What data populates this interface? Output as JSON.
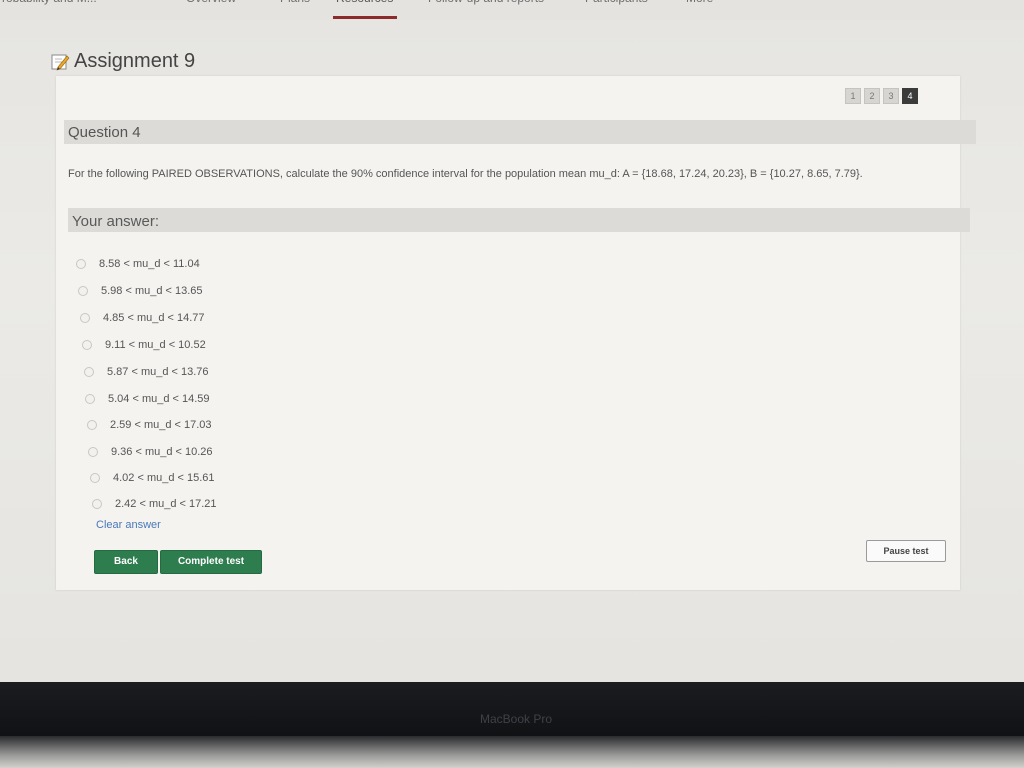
{
  "nav": {
    "tabs": [
      {
        "label": "Probability and M..."
      },
      {
        "label": "Overview"
      },
      {
        "label": "Plans"
      },
      {
        "label": "Resources"
      },
      {
        "label": "Follow-up and reports"
      },
      {
        "label": "Participants"
      },
      {
        "label": "More"
      }
    ],
    "active_tab": "Resources"
  },
  "assignment": {
    "title": "Assignment 9",
    "icon": "pencil-edit-icon"
  },
  "pager": {
    "pages": [
      "1",
      "2",
      "3",
      "4"
    ],
    "current": "4"
  },
  "question": {
    "heading": "Question 4",
    "text": "For the following PAIRED OBSERVATIONS, calculate the 90% confidence interval for the population mean mu_d: A = {18.68, 17.24, 20.23}, B = {10.27, 8.65, 7.79}."
  },
  "answer": {
    "heading": "Your answer:",
    "options": [
      "8.58 < mu_d < 11.04",
      "5.98 < mu_d < 13.65",
      "4.85 < mu_d < 14.77",
      "9.11 < mu_d < 10.52",
      "5.87 < mu_d < 13.76",
      "5.04 < mu_d < 14.59",
      "2.59 < mu_d < 17.03",
      "9.36 < mu_d < 10.26",
      "4.02 < mu_d < 15.61",
      "2.42 < mu_d < 17.21"
    ],
    "clear_label": "Clear answer"
  },
  "buttons": {
    "back": "Back",
    "complete": "Complete test",
    "pause": "Pause test"
  },
  "device": {
    "brand": "MacBook Pro"
  },
  "colors": {
    "accent_green": "#2e7d4f",
    "link_blue": "#4a79b8",
    "active_tab_underline": "#8b2b2b"
  }
}
